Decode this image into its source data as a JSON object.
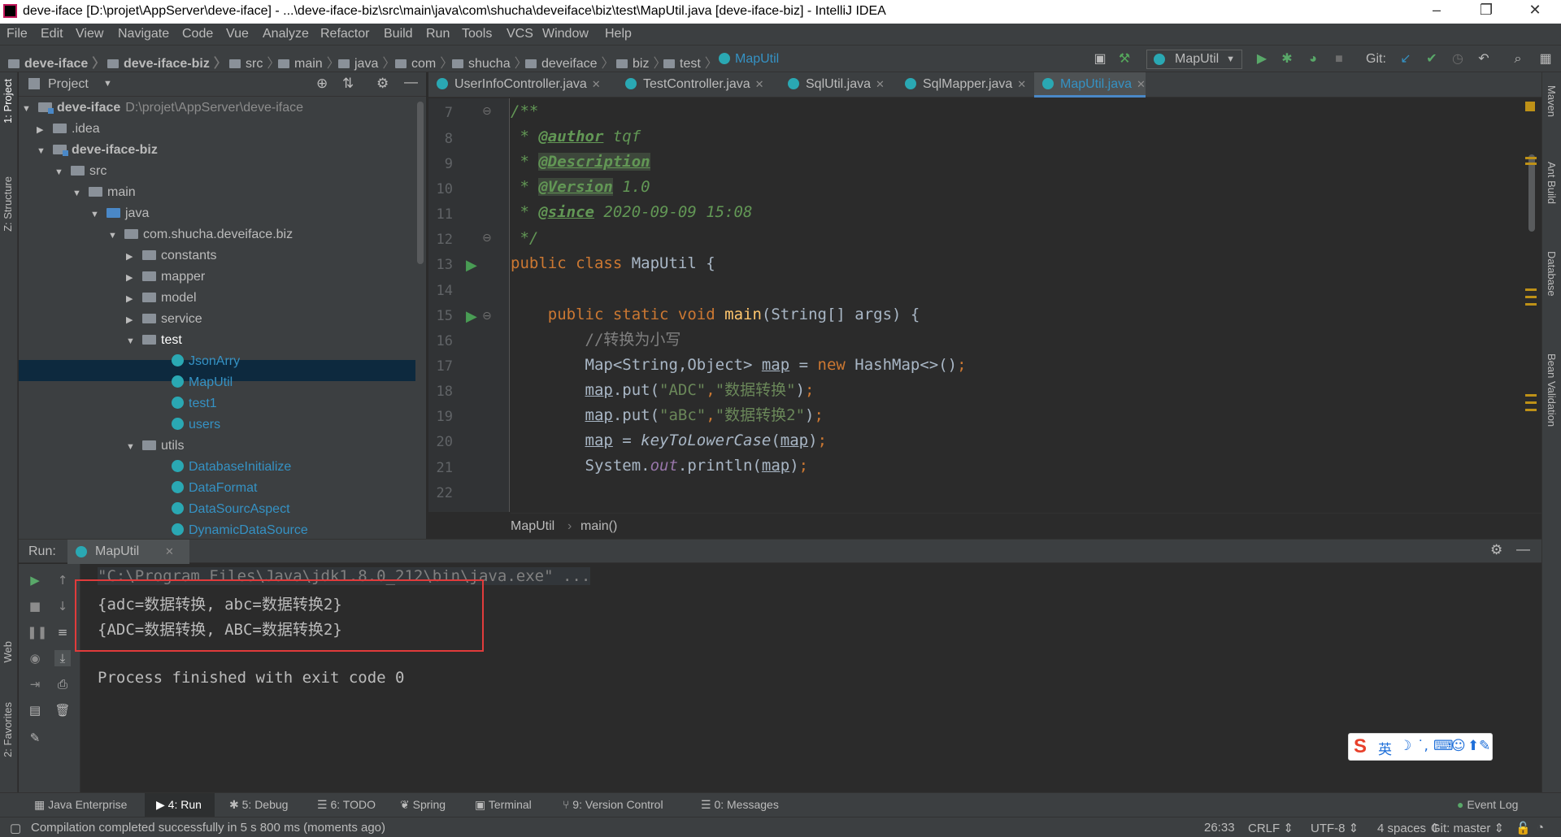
{
  "window": {
    "title": "deve-iface [D:\\projet\\AppServer\\deve-iface] - ...\\deve-iface-biz\\src\\main\\java\\com\\shucha\\deveiface\\biz\\test\\MapUtil.java [deve-iface-biz] - IntelliJ IDEA"
  },
  "menu": [
    "File",
    "Edit",
    "View",
    "Navigate",
    "Code",
    "Vue",
    "Analyze",
    "Refactor",
    "Build",
    "Run",
    "Tools",
    "VCS",
    "Window",
    "Help"
  ],
  "breadcrumbs": [
    "deve-iface",
    "deve-iface-biz",
    "src",
    "main",
    "java",
    "com",
    "shucha",
    "deveiface",
    "biz",
    "test",
    "MapUtil"
  ],
  "toolbar": {
    "run_config": "MapUtil",
    "git_label": "Git:"
  },
  "project_panel": {
    "title": "Project",
    "tree": [
      {
        "label": "deve-iface",
        "path": "D:\\projet\\AppServer\\deve-iface"
      },
      {
        "label": ".idea"
      },
      {
        "label": "deve-iface-biz"
      },
      {
        "label": "src"
      },
      {
        "label": "main"
      },
      {
        "label": "java"
      },
      {
        "label": "com.shucha.deveiface.biz"
      },
      {
        "label": "constants"
      },
      {
        "label": "mapper"
      },
      {
        "label": "model"
      },
      {
        "label": "service"
      },
      {
        "label": "test"
      },
      {
        "label": "JsonArry"
      },
      {
        "label": "MapUtil"
      },
      {
        "label": "test1"
      },
      {
        "label": "users"
      },
      {
        "label": "utils"
      },
      {
        "label": "DatabaseInitialize"
      },
      {
        "label": "DataFormat"
      },
      {
        "label": "DataSourcAspect"
      },
      {
        "label": "DynamicDataSource"
      }
    ]
  },
  "editor": {
    "tabs": [
      "UserInfoController.java",
      "TestController.java",
      "SqlUtil.java",
      "SqlMapper.java",
      "MapUtil.java"
    ],
    "active_tab": "MapUtil.java",
    "line_numbers": [
      "7",
      "8",
      "9",
      "10",
      "11",
      "12",
      "13",
      "14",
      "15",
      "16",
      "17",
      "18",
      "19",
      "20",
      "21",
      "22"
    ],
    "code": {
      "l7": "/**",
      "l8_tag": "@author",
      "l8_val": " tqf",
      "l9_tag": "@Description",
      "l10_tag": "@Version",
      "l10_val": " 1.0",
      "l11_tag": "@since",
      "l11_val": " 2020-09-09 15:08",
      "l12": " */",
      "l13_kw": "public class",
      "l13_rest": " MapUtil {",
      "l15_kw": "public static void",
      "l15_fn": "main",
      "l15_rest": "(String[] args) {",
      "l16": "//转换为小写",
      "l17_a": "Map<String,Object> ",
      "l17_var": "map",
      "l17_b": " = ",
      "l17_kw": "new",
      "l17_c": " HashMap<>()",
      "l18_var": "map",
      "l18_a": ".put(",
      "l18_s1": "\"ADC\"",
      "l18_comma": ",",
      "l18_s2": "\"数据转换\"",
      "l18_b": ")",
      "l19_var": "map",
      "l19_a": ".put(",
      "l19_s1": "\"aBc\"",
      "l19_comma": ",",
      "l19_s2": "\"数据转换2\"",
      "l19_b": ")",
      "l20_var": "map",
      "l20_a": " = ",
      "l20_fn": "keyToLowerCase",
      "l20_b": "(",
      "l20_var2": "map",
      "l20_c": ")",
      "l21_a": "System.",
      "l21_out": "out",
      "l21_b": ".println(",
      "l21_var": "map",
      "l21_c": ")",
      "semi": ";"
    },
    "breadcrumb": [
      "MapUtil",
      "main()"
    ]
  },
  "run_panel": {
    "label": "Run:",
    "tab": "MapUtil",
    "console": [
      "\"C:\\Program Files\\Java\\jdk1.8.0_212\\bin\\java.exe\" ...",
      "{adc=数据转换, abc=数据转换2}",
      "{ADC=数据转换, ABC=数据转换2}",
      "Process finished with exit code 0"
    ]
  },
  "left_strip": [
    "1: Project",
    "Z: Structure",
    "Web",
    "2: Favorites"
  ],
  "right_strip": [
    "Maven",
    "Ant Build",
    "Database",
    "Bean Validation"
  ],
  "bottom_tabs": [
    "Java Enterprise",
    "4: Run",
    "5: Debug",
    "6: TODO",
    "Spring",
    "Terminal",
    "9: Version Control",
    "0: Messages"
  ],
  "event_log": "Event Log",
  "ime": {
    "lang": "英"
  },
  "status": {
    "message": "Compilation completed successfully in 5 s 800 ms (moments ago)",
    "position": "26:33",
    "line_sep": "CRLF ⇕",
    "encoding": "UTF-8 ⇕",
    "indent": "4 spaces ⇕",
    "git_branch": "Git: master ⇕"
  },
  "colors": {
    "accent": "#4a88c7",
    "editor_bg": "#2b2b2b",
    "panel_bg": "#3c3f41",
    "highlight_box": "#e03b3b"
  }
}
